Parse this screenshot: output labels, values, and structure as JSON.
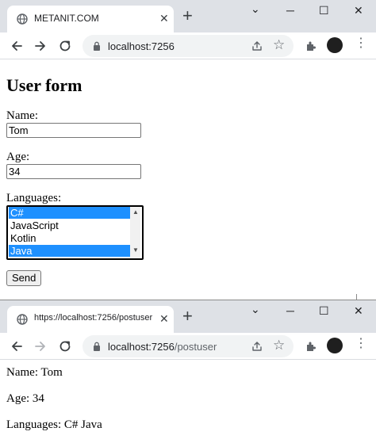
{
  "window1": {
    "tab_title": "METANIT.COM",
    "url_host": "localhost:7256",
    "url_path": "",
    "form": {
      "heading": "User form",
      "name_label": "Name:",
      "name_value": "Tom",
      "age_label": "Age:",
      "age_value": "34",
      "languages_label": "Languages:",
      "languages": [
        {
          "label": "C#",
          "selected": true
        },
        {
          "label": "JavaScript",
          "selected": false
        },
        {
          "label": "Kotlin",
          "selected": false
        },
        {
          "label": "Java",
          "selected": true
        }
      ],
      "send_label": "Send"
    }
  },
  "window2": {
    "tab_title": "https://localhost:7256/postuser",
    "url_host": "localhost:7256",
    "url_path": "/postuser",
    "result": {
      "name_line": "Name: Tom",
      "age_line": "Age: 34",
      "languages_line": "Languages: C# Java"
    }
  },
  "icons": {
    "close": "✕",
    "new_tab": "+",
    "minimize": "─",
    "maximize": "☐",
    "chevron": "⌄",
    "star": "☆",
    "menu": "⋮"
  },
  "colors": {
    "tabstrip": "#dee1e6",
    "selection": "#1e90ff",
    "omnibox": "#f1f3f4"
  }
}
